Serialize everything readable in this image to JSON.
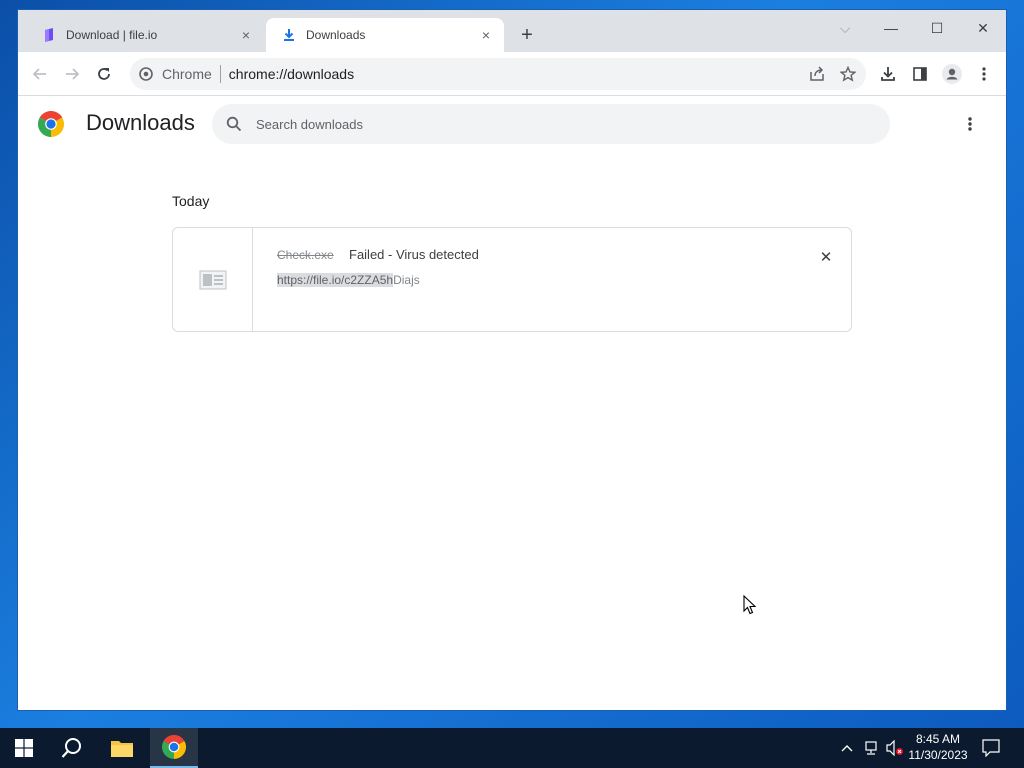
{
  "tabs": [
    {
      "title": "Download | file.io",
      "icon": "fileio-icon",
      "close": "×"
    },
    {
      "title": "Downloads",
      "icon": "download-icon",
      "close": "×"
    }
  ],
  "new_tab_label": "+",
  "window_controls": {
    "tab_search": "⌵",
    "minimize": "—",
    "maximize": "☐",
    "close": "✕"
  },
  "omnibox": {
    "chip": "Chrome",
    "url": "chrome://downloads"
  },
  "page": {
    "title": "Downloads",
    "search_placeholder": "Search downloads",
    "section": "Today",
    "download": {
      "file_name": "Check.exe",
      "status": "Failed - Virus detected",
      "url_highlighted": "https://file.io/c2ZZA5h",
      "url_rest": "Diajs",
      "remove_label": "✕"
    }
  },
  "taskbar": {
    "clock_time": "8:45 AM",
    "clock_date": "11/30/2023"
  },
  "colors": {
    "tabstrip": "#dee1e6",
    "accent": "#1a73e8",
    "taskbar": "#0b1a2e"
  }
}
